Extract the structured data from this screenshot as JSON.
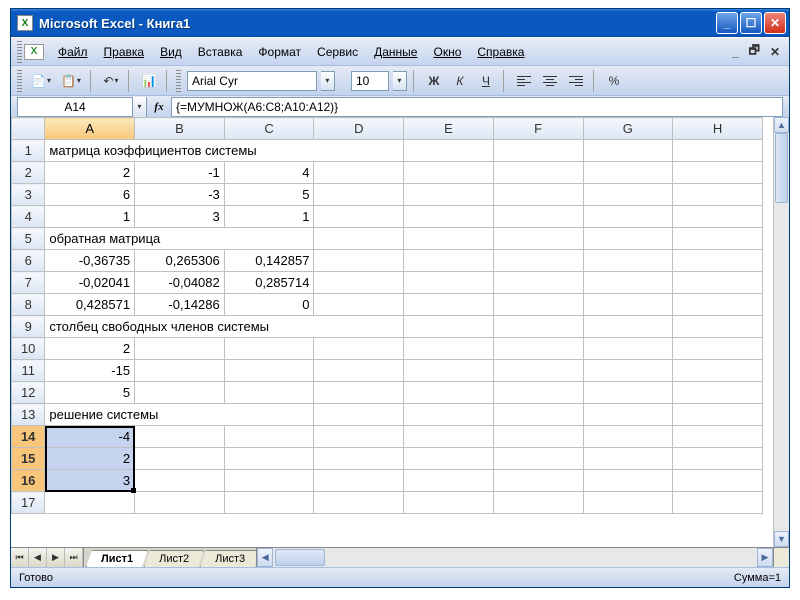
{
  "title": "Microsoft Excel - Книга1",
  "menu": {
    "file": "Файл",
    "edit": "Правка",
    "view": "Вид",
    "insert": "Вставка",
    "format": "Формат",
    "service": "Сервис",
    "data": "Данные",
    "window": "Окно",
    "help": "Справка"
  },
  "toolbar": {
    "font": "Arial Cyr",
    "size": "10",
    "bold": "Ж",
    "italic": "К",
    "underline": "Ч",
    "percent": "%"
  },
  "namebox": "A14",
  "formula": "{=МУМНОЖ(A6:C8;A10:A12)}",
  "fx": "fx",
  "columns": [
    "A",
    "B",
    "C",
    "D",
    "E",
    "F",
    "G",
    "H"
  ],
  "rows": [
    {
      "n": "1",
      "cells": [
        {
          "v": "матрица коэффициентов системы",
          "a": "left",
          "span": 4
        },
        {
          "v": ""
        },
        {
          "v": ""
        },
        {
          "v": ""
        },
        {
          "v": ""
        }
      ]
    },
    {
      "n": "2",
      "cells": [
        {
          "v": "2",
          "a": "right"
        },
        {
          "v": "-1",
          "a": "right"
        },
        {
          "v": "4",
          "a": "right"
        },
        {
          "v": ""
        },
        {
          "v": ""
        },
        {
          "v": ""
        },
        {
          "v": ""
        },
        {
          "v": ""
        }
      ]
    },
    {
      "n": "3",
      "cells": [
        {
          "v": "6",
          "a": "right"
        },
        {
          "v": "-3",
          "a": "right"
        },
        {
          "v": "5",
          "a": "right"
        },
        {
          "v": ""
        },
        {
          "v": ""
        },
        {
          "v": ""
        },
        {
          "v": ""
        },
        {
          "v": ""
        }
      ]
    },
    {
      "n": "4",
      "cells": [
        {
          "v": "1",
          "a": "right"
        },
        {
          "v": "3",
          "a": "right"
        },
        {
          "v": "1",
          "a": "right"
        },
        {
          "v": ""
        },
        {
          "v": ""
        },
        {
          "v": ""
        },
        {
          "v": ""
        },
        {
          "v": ""
        }
      ]
    },
    {
      "n": "5",
      "cells": [
        {
          "v": "обратная матрица",
          "a": "left",
          "span": 3
        },
        {
          "v": ""
        },
        {
          "v": ""
        },
        {
          "v": ""
        },
        {
          "v": ""
        },
        {
          "v": ""
        }
      ]
    },
    {
      "n": "6",
      "cells": [
        {
          "v": "-0,36735",
          "a": "right"
        },
        {
          "v": "0,265306",
          "a": "right"
        },
        {
          "v": "0,142857",
          "a": "right"
        },
        {
          "v": ""
        },
        {
          "v": ""
        },
        {
          "v": ""
        },
        {
          "v": ""
        },
        {
          "v": ""
        }
      ]
    },
    {
      "n": "7",
      "cells": [
        {
          "v": "-0,02041",
          "a": "right"
        },
        {
          "v": "-0,04082",
          "a": "right"
        },
        {
          "v": "0,285714",
          "a": "right"
        },
        {
          "v": ""
        },
        {
          "v": ""
        },
        {
          "v": ""
        },
        {
          "v": ""
        },
        {
          "v": ""
        }
      ]
    },
    {
      "n": "8",
      "cells": [
        {
          "v": "0,428571",
          "a": "right"
        },
        {
          "v": "-0,14286",
          "a": "right"
        },
        {
          "v": "0",
          "a": "right"
        },
        {
          "v": ""
        },
        {
          "v": ""
        },
        {
          "v": ""
        },
        {
          "v": ""
        },
        {
          "v": ""
        }
      ]
    },
    {
      "n": "9",
      "cells": [
        {
          "v": "столбец свободных членов системы",
          "a": "left",
          "span": 4
        },
        {
          "v": ""
        },
        {
          "v": ""
        },
        {
          "v": ""
        },
        {
          "v": ""
        }
      ]
    },
    {
      "n": "10",
      "cells": [
        {
          "v": "2",
          "a": "right"
        },
        {
          "v": ""
        },
        {
          "v": ""
        },
        {
          "v": ""
        },
        {
          "v": ""
        },
        {
          "v": ""
        },
        {
          "v": ""
        },
        {
          "v": ""
        }
      ]
    },
    {
      "n": "11",
      "cells": [
        {
          "v": "-15",
          "a": "right"
        },
        {
          "v": ""
        },
        {
          "v": ""
        },
        {
          "v": ""
        },
        {
          "v": ""
        },
        {
          "v": ""
        },
        {
          "v": ""
        },
        {
          "v": ""
        }
      ]
    },
    {
      "n": "12",
      "cells": [
        {
          "v": "5",
          "a": "right"
        },
        {
          "v": ""
        },
        {
          "v": ""
        },
        {
          "v": ""
        },
        {
          "v": ""
        },
        {
          "v": ""
        },
        {
          "v": ""
        },
        {
          "v": ""
        }
      ]
    },
    {
      "n": "13",
      "cells": [
        {
          "v": "решение системы",
          "a": "left",
          "span": 3
        },
        {
          "v": ""
        },
        {
          "v": ""
        },
        {
          "v": ""
        },
        {
          "v": ""
        },
        {
          "v": ""
        }
      ]
    },
    {
      "n": "14",
      "cells": [
        {
          "v": "-4",
          "a": "right",
          "sel": true
        },
        {
          "v": ""
        },
        {
          "v": ""
        },
        {
          "v": ""
        },
        {
          "v": ""
        },
        {
          "v": ""
        },
        {
          "v": ""
        },
        {
          "v": ""
        }
      ],
      "selrow": true
    },
    {
      "n": "15",
      "cells": [
        {
          "v": "2",
          "a": "right",
          "sel": true
        },
        {
          "v": ""
        },
        {
          "v": ""
        },
        {
          "v": ""
        },
        {
          "v": ""
        },
        {
          "v": ""
        },
        {
          "v": ""
        },
        {
          "v": ""
        }
      ],
      "selrow": true
    },
    {
      "n": "16",
      "cells": [
        {
          "v": "3",
          "a": "right",
          "sel": true
        },
        {
          "v": ""
        },
        {
          "v": ""
        },
        {
          "v": ""
        },
        {
          "v": ""
        },
        {
          "v": ""
        },
        {
          "v": ""
        },
        {
          "v": ""
        }
      ],
      "selrow": true
    },
    {
      "n": "17",
      "cells": [
        {
          "v": ""
        },
        {
          "v": ""
        },
        {
          "v": ""
        },
        {
          "v": ""
        },
        {
          "v": ""
        },
        {
          "v": ""
        },
        {
          "v": ""
        },
        {
          "v": ""
        }
      ]
    }
  ],
  "sheets": {
    "tab1": "Лист1",
    "tab2": "Лист2",
    "tab3": "Лист3"
  },
  "status": {
    "ready": "Готово",
    "sum": "Сумма=1"
  }
}
